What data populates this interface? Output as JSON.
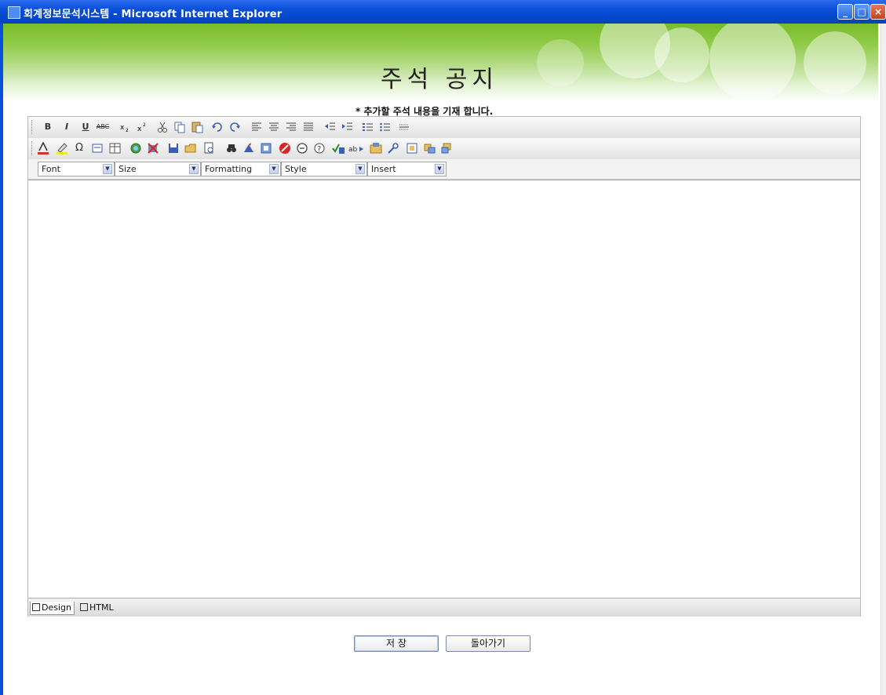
{
  "window": {
    "title": "회계정보문석시스템 - Microsoft Internet Explorer",
    "minimize_label": "_",
    "maximize_label": "□",
    "close_label": "×"
  },
  "page": {
    "title": "주석 공지",
    "subtitle": "* 추가할 주석 내용을 기재 합니다."
  },
  "toolbar1": [
    "B",
    "I",
    "U",
    "ABC"
  ],
  "toolbar3": {
    "selects": [
      {
        "label": "Font"
      },
      {
        "label": "Size"
      },
      {
        "label": "Formatting"
      },
      {
        "label": "Style"
      },
      {
        "label": "Insert"
      }
    ]
  },
  "editor": {
    "mode_tabs": [
      {
        "label": "Design",
        "active": true
      },
      {
        "label": "HTML",
        "active": false
      }
    ]
  },
  "actions": {
    "save_label": "저 장",
    "back_label": "돌아가기"
  }
}
